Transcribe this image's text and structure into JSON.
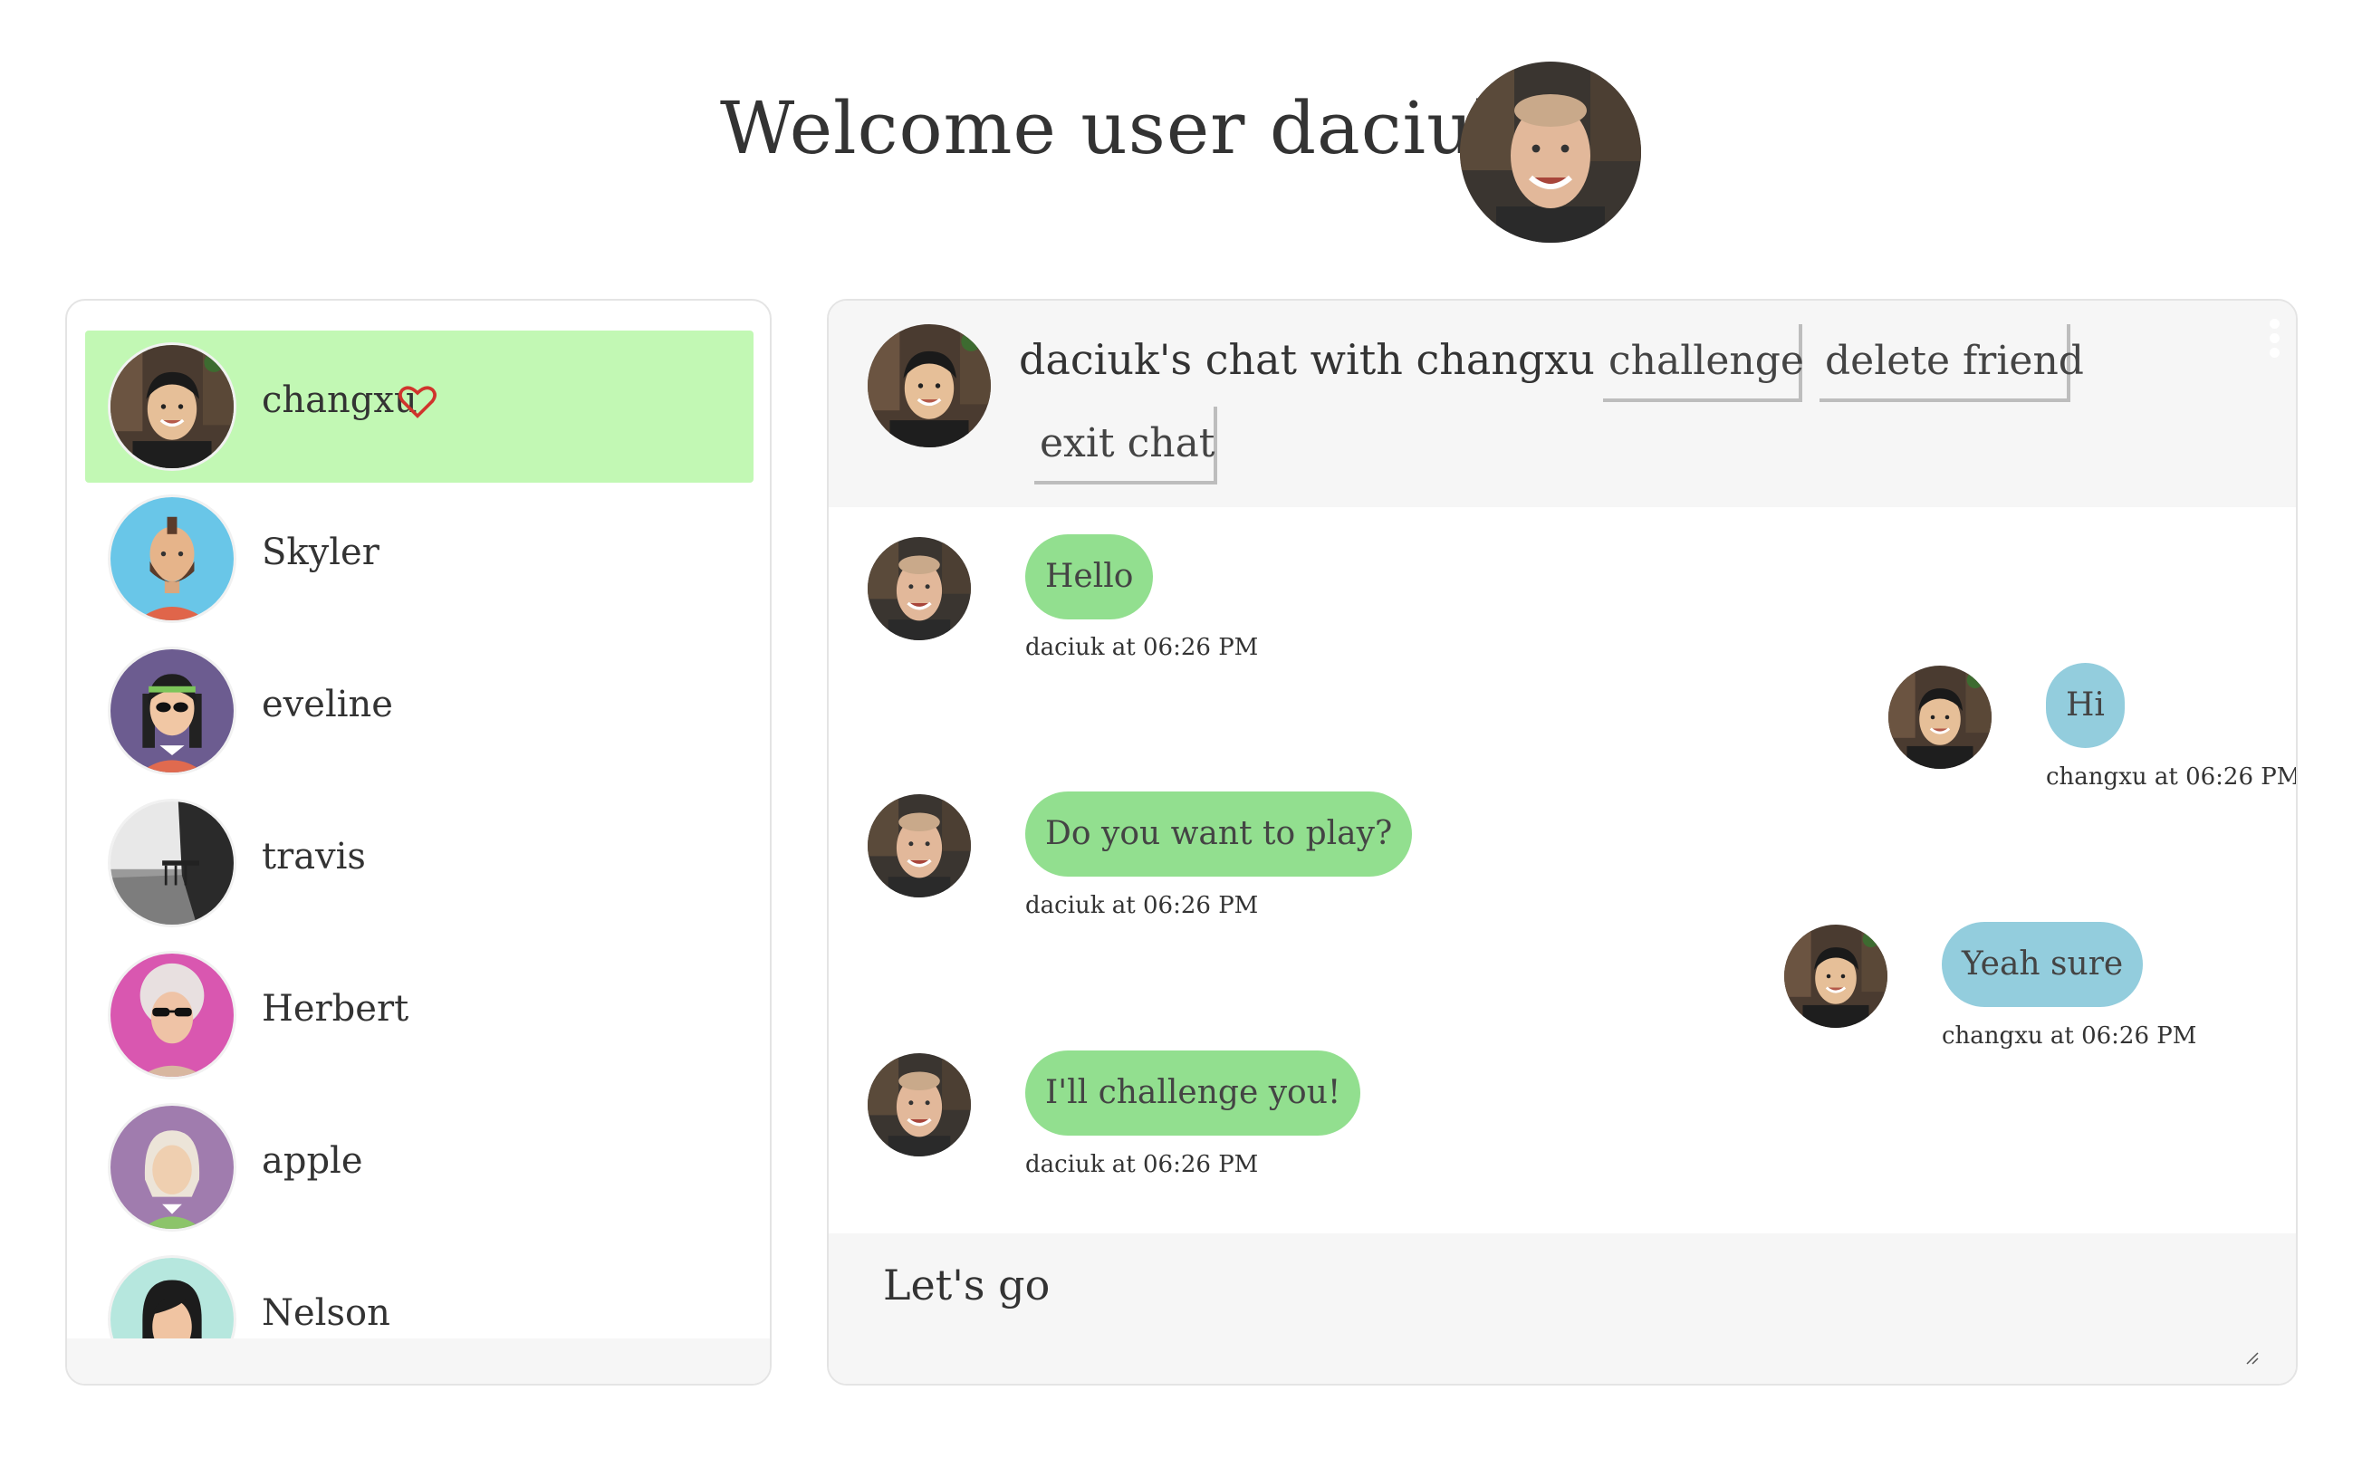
{
  "header": {
    "welcome_text": "Welcome user daciuk",
    "avatar_icon": "user-daciuk-avatar"
  },
  "friends": {
    "items": [
      {
        "name": "changxu",
        "active": true,
        "favorite": true,
        "avatar": "photo-changxu"
      },
      {
        "name": "Skyler",
        "active": false,
        "favorite": false,
        "avatar": "bearded-man-avatar"
      },
      {
        "name": "eveline",
        "active": false,
        "favorite": false,
        "avatar": "woman-sunglasses-avatar"
      },
      {
        "name": "travis",
        "active": false,
        "favorite": false,
        "avatar": "pier-photo-avatar"
      },
      {
        "name": "Herbert",
        "active": false,
        "favorite": false,
        "avatar": "old-woman-sunglasses-avatar"
      },
      {
        "name": "apple",
        "active": false,
        "favorite": false,
        "avatar": "grandma-avatar"
      },
      {
        "name": "Nelson",
        "active": false,
        "favorite": false,
        "avatar": "woman-black-hair-avatar"
      }
    ],
    "heart_color": "#d0342c",
    "active_color": "#c2f8b4"
  },
  "chat": {
    "title": "daciuk's chat with changxu",
    "buttons": {
      "challenge": "challenge",
      "delete_friend": "delete friend",
      "exit_chat": "exit chat"
    },
    "messages": [
      {
        "from": "me",
        "text": "Hello",
        "meta": "daciuk at 06:26 PM"
      },
      {
        "from": "them",
        "text": "Hi",
        "meta": "changxu at 06:26 PM"
      },
      {
        "from": "me",
        "text": "Do you want to play?",
        "meta": "daciuk at 06:26 PM"
      },
      {
        "from": "them",
        "text": "Yeah sure",
        "meta": "changxu at 06:26 PM"
      },
      {
        "from": "me",
        "text": "I'll challenge you!",
        "meta": "daciuk at 06:26 PM"
      }
    ],
    "input_value": "Let's go",
    "colors": {
      "me_bubble": "#92df8f",
      "them_bubble": "#93cddd",
      "panel_bg": "#f6f6f6"
    }
  }
}
